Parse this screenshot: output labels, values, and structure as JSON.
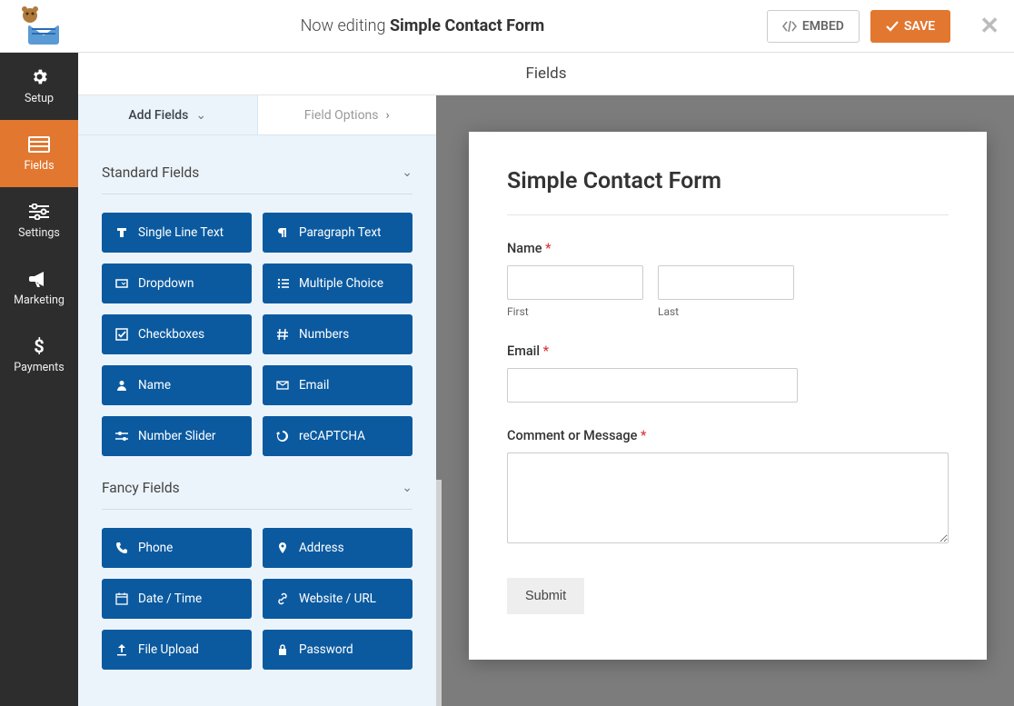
{
  "header": {
    "now_editing": "Now editing",
    "form_name": "Simple Contact Form",
    "embed": "EMBED",
    "save": "SAVE"
  },
  "sidebar": {
    "setup": "Setup",
    "fields": "Fields",
    "settings": "Settings",
    "marketing": "Marketing",
    "payments": "Payments"
  },
  "main": {
    "title": "Fields"
  },
  "left": {
    "tab_add": "Add Fields",
    "tab_opts": "Field Options",
    "group_standard": "Standard Fields",
    "group_fancy": "Fancy Fields",
    "standard": [
      "Single Line Text",
      "Paragraph Text",
      "Dropdown",
      "Multiple Choice",
      "Checkboxes",
      "Numbers",
      "Name",
      "Email",
      "Number Slider",
      "reCAPTCHA"
    ],
    "fancy": [
      "Phone",
      "Address",
      "Date / Time",
      "Website / URL",
      "File Upload",
      "Password"
    ]
  },
  "preview": {
    "title": "Simple Contact Form",
    "name_label": "Name",
    "first": "First",
    "last": "Last",
    "email_label": "Email",
    "comment_label": "Comment or Message",
    "submit": "Submit"
  }
}
